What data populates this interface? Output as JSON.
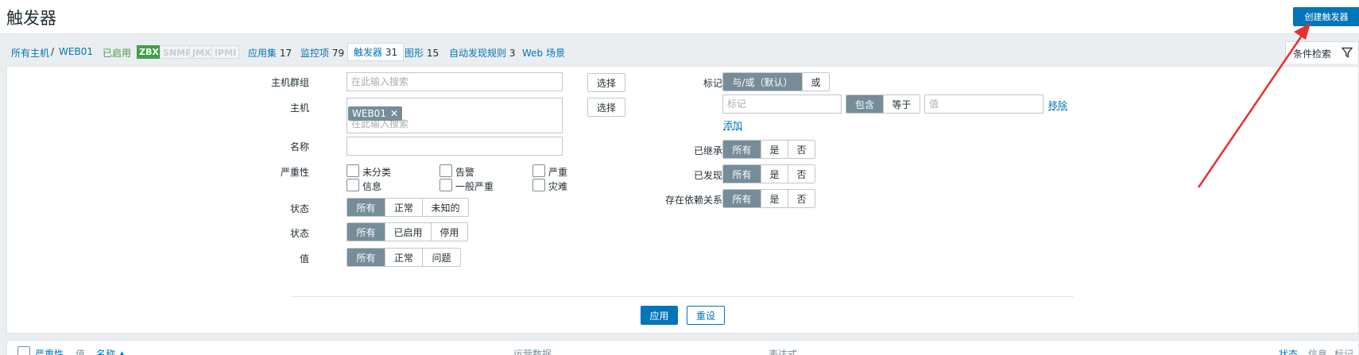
{
  "header": {
    "title": "触发器",
    "create_button": "创建触发器"
  },
  "nav": {
    "all_hosts": "所有主机",
    "separator": "/",
    "host": "WEB01",
    "status": "已启用",
    "tags": [
      "ZBX",
      "SNMP",
      "JMX",
      "IPMI"
    ],
    "items": [
      {
        "label": "应用集",
        "count": "17"
      },
      {
        "label": "监控项",
        "count": "79"
      },
      {
        "label": "触发器",
        "count": "31"
      },
      {
        "label": "图形",
        "count": "15"
      },
      {
        "label": "自动发现规则",
        "count": "3"
      },
      {
        "label": "Web 场景",
        "count": ""
      }
    ],
    "filter_tab": "条件检索"
  },
  "filter": {
    "host_group_label": "主机群组",
    "host_group_placeholder": "在此输入搜索",
    "select": "选择",
    "host_label": "主机",
    "host_chip": "WEB01",
    "host_placeholder": "在此输入搜索",
    "name_label": "名称",
    "severity_label": "严重性",
    "severities": [
      "未分类",
      "告警",
      "严重",
      "信息",
      "一般严重",
      "灾难"
    ],
    "state_label": "状态",
    "state_options": [
      "所有",
      "正常",
      "未知的"
    ],
    "status_label": "状态",
    "status_options": [
      "所有",
      "已启用",
      "停用"
    ],
    "value_label": "值",
    "value_options": [
      "所有",
      "正常",
      "问题"
    ],
    "tags_label": "标记",
    "tags_mode": [
      "与/或（默认）",
      "或"
    ],
    "tag_placeholder": "标记",
    "tag_operator": [
      "包含",
      "等于"
    ],
    "tag_value_placeholder": "值",
    "remove": "移除",
    "add": "添加",
    "inherited_label": "已继承",
    "discovered_label": "已发现",
    "dependencies_label": "存在依赖关系",
    "yes_no": [
      "所有",
      "是",
      "否"
    ],
    "apply": "应用",
    "reset": "重设"
  },
  "table": {
    "columns": [
      "严重性",
      "值",
      "名称 ▲",
      "运营数据",
      "表达式",
      "状态",
      "信息",
      "标记"
    ]
  },
  "colors": {
    "accent": "#0275b8",
    "segment_on": "#768d99",
    "enabled_green": "#429e47",
    "arrow": "#e8312f"
  }
}
